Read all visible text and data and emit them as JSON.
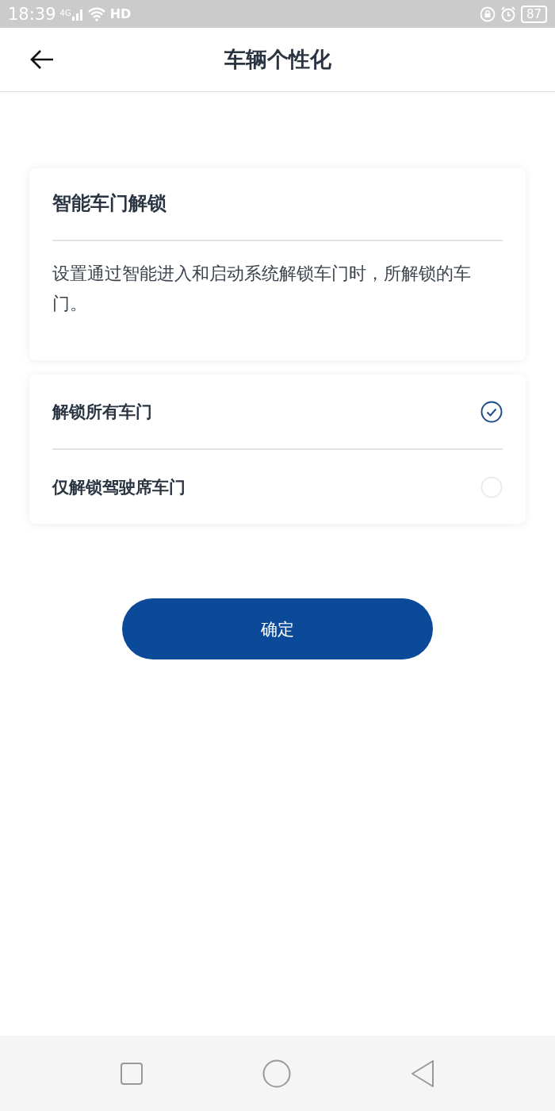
{
  "status_bar": {
    "time": "18:39",
    "network": "4G",
    "hd": "HD",
    "battery": "87"
  },
  "header": {
    "title": "车辆个性化"
  },
  "info_card": {
    "title": "智能车门解锁",
    "description": "设置通过智能进入和启动系统解锁车门时，所解锁的车门。"
  },
  "options": [
    {
      "label": "解锁所有车门",
      "selected": true
    },
    {
      "label": "仅解锁驾驶席车门",
      "selected": false
    }
  ],
  "confirm_button": "确定"
}
